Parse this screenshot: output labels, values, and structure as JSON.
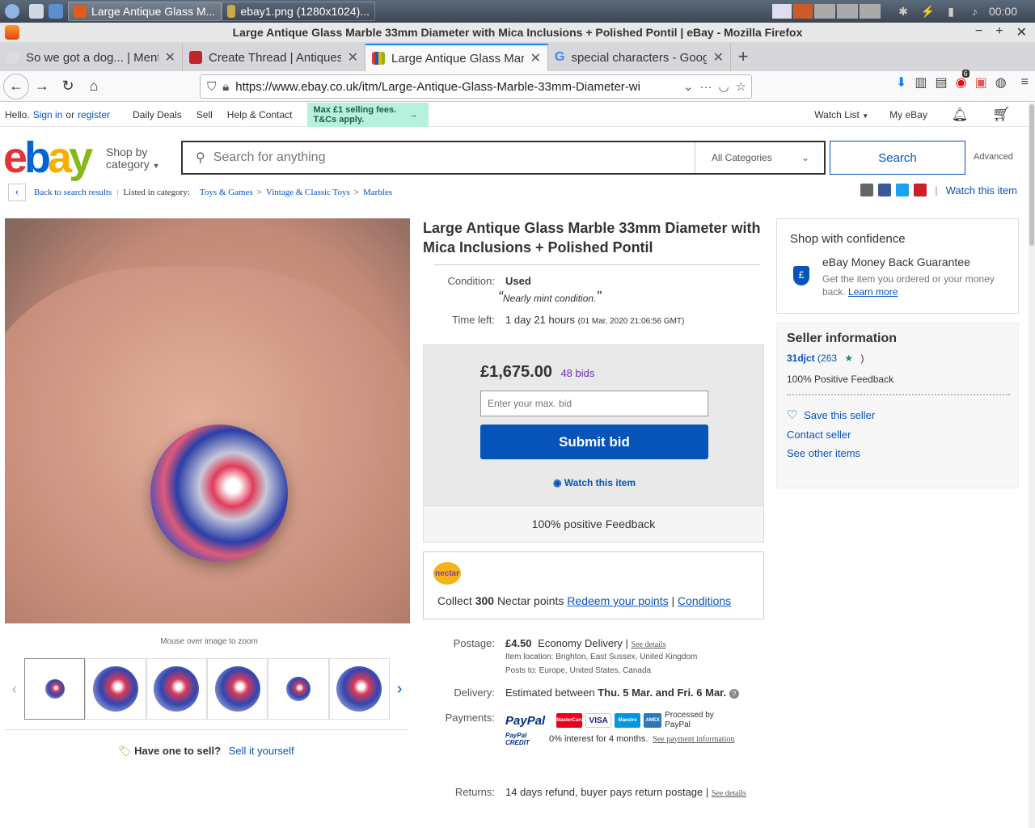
{
  "taskbar": {
    "tasks": [
      {
        "label": "Large Antique Glass M..."
      },
      {
        "label": "ebay1.png (1280x1024)..."
      }
    ],
    "clock": "00:00"
  },
  "window": {
    "title": "Large Antique Glass Marble 33mm Diameter with Mica Inclusions + Polished Pontil | eBay - Mozilla Firefox"
  },
  "tabs": [
    {
      "label": "So we got a dog... | Ment"
    },
    {
      "label": "Create Thread | Antiques"
    },
    {
      "label": "Large Antique Glass Marl"
    },
    {
      "label": "special characters - Goog"
    }
  ],
  "url": "https://www.ebay.co.uk/itm/Large-Antique-Glass-Marble-33mm-Diameter-wi",
  "badge_count": "6",
  "topnav": {
    "hello": "Hello.",
    "signin": "Sign in",
    "or": "or",
    "register": "register",
    "daily_deals": "Daily Deals",
    "sell": "Sell",
    "help": "Help & Contact",
    "promo": "Max £1 selling fees. T&Cs apply.",
    "watch_list": "Watch List",
    "my_ebay": "My eBay"
  },
  "header": {
    "shop_by": "Shop by",
    "category": "category",
    "search_placeholder": "Search for anything",
    "all_categories": "All Categories",
    "search_button": "Search",
    "advanced": "Advanced"
  },
  "crumbs": {
    "back": "Back to search results",
    "listed": "Listed in category:",
    "items": [
      "Toys & Games",
      "Vintage & Classic Toys",
      "Marbles"
    ],
    "watch": "Watch this item"
  },
  "gallery": {
    "zoom_hint": "Mouse over image to zoom"
  },
  "have_one": {
    "question": "Have one to sell?",
    "link": "Sell it yourself"
  },
  "item": {
    "title": "Large Antique Glass Marble 33mm Diameter with Mica Inclusions + Polished Pontil",
    "condition_label": "Condition:",
    "condition": "Used",
    "condition_note": "Nearly mint condition.",
    "time_label": "Time left:",
    "time_left": "1 day 21 hours",
    "time_end": "(01 Mar, 2020  21:06:56 GMT)",
    "price": "£1,675.00",
    "bids": "48 bids",
    "bid_placeholder": "Enter your max. bid",
    "submit": "Submit bid",
    "watch": "Watch this item",
    "positive_feedback": "100% positive Feedback"
  },
  "nectar": {
    "logo": "nectar",
    "collect": "Collect",
    "points": "300",
    "points_suffix": "Nectar points",
    "redeem": "Redeem your points",
    "conditions": "Conditions"
  },
  "postage": {
    "label": "Postage:",
    "cost": "£4.50",
    "method": "Economy Delivery",
    "see_details": "See details",
    "location": "Item location:  Brighton, East Sussex, United Kingdom",
    "posts_to": "Posts to:  Europe, United States, Canada"
  },
  "delivery": {
    "label": "Delivery:",
    "prefix": "Estimated between",
    "dates": "Thu. 5 Mar. and Fri. 6 Mar."
  },
  "payments": {
    "label": "Payments:",
    "paypal": "PayPal",
    "cards": [
      "MasterCard",
      "VISA",
      "Maestro",
      "AMEX"
    ],
    "processed": "Processed by PayPal",
    "credit_line": "0% interest for 4 months.",
    "credit_logo": "PayPal CREDIT",
    "see_payment": "See payment information"
  },
  "returns": {
    "label": "Returns:",
    "text": "14 days refund, buyer pays return postage |",
    "see_details": "See details"
  },
  "confidence": {
    "title": "Shop with confidence",
    "guarantee": "eBay Money Back Guarantee",
    "desc": "Get the item you ordered or your money back.",
    "learn": "Learn more"
  },
  "seller": {
    "heading": "Seller information",
    "name": "31djct",
    "score": "(263",
    "score_end": ")",
    "feedback": "100% Positive Feedback",
    "save": "Save this seller",
    "contact": "Contact seller",
    "other": "See other items"
  },
  "colors": {
    "ebay_blue": "#0654ba",
    "bid_purple": "#6b2fb3"
  }
}
